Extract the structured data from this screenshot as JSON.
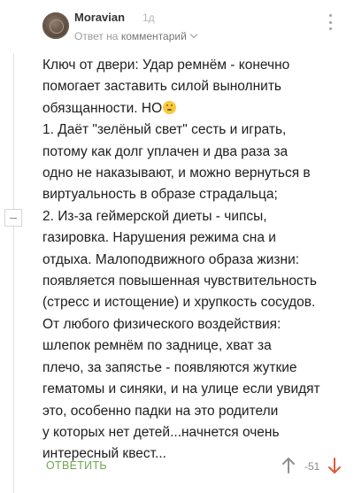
{
  "comment": {
    "username": "Moravian",
    "age": "1д",
    "reply_prefix": "Ответ на",
    "reply_target": "комментарий",
    "lines": [
      "Ключ от двери: Удар ремнём - конечно",
      "помогает заставить силой вынолнить",
      "обязщанности. НО",
      "1. Даёт \"зелёный свет\" сесть и играть,",
      "потому как долг уплачен и два раза за",
      "одно не наказывают, и можно вернуться в",
      "виртуальность в образе страдальца;",
      "2. Из-за геймерской диеты - чипсы,",
      "газировка. Нарушения режима сна и",
      "отдыха. Малоподвижного образа жизни:",
      "появляется повышенная чувствительность",
      "(стресс и истощение) и хрупкость сосудов.",
      "От любого физического воздействия:",
      "шлепок ремнём по заднице, хват за",
      "плечо, за запястье - появляются жуткие",
      "гематомы и синяки, и на улице если увидят",
      "это, особенно падки на это родители",
      "у которых нет детей...начнется очень",
      "интересный квест..."
    ],
    "reply_button": "ОТВЕТИТЬ",
    "score": "-51"
  },
  "icons": {
    "emoji": "thinking-shush-emoji",
    "more": "more-vertical-icon",
    "collapse": "collapse-minus-icon",
    "vote_up": "arrow-up-icon",
    "vote_down": "arrow-down-icon"
  },
  "colors": {
    "reply_button": "#6fa84c",
    "vote_up": "#8f8f8f",
    "vote_down": "#e0593a",
    "score": "#8a8a8a"
  }
}
